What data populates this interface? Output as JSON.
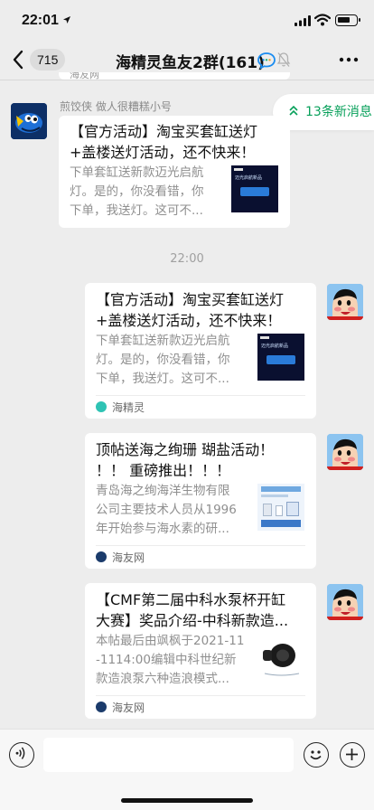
{
  "status": {
    "time": "22:01"
  },
  "nav": {
    "unread_count": "715",
    "title": "海精灵鱼友2群(161)"
  },
  "peek_text": "海友网",
  "new_messages": "13条新消息",
  "timestamp": "22:00",
  "messages": [
    {
      "sender": "煎饺侠 做人很糟糕小号",
      "title_lines": [
        "【官方活动】淘宝买套缸送灯",
        "+盖楼送灯活动，还不快来！"
      ],
      "desc_lines": [
        "下单套缸送新款迈光启航",
        "灯。是的，你没看错，你",
        "下单，我送灯。这可不..."
      ],
      "thumb_text": "迈光启航新品"
    },
    {
      "title_lines": [
        "【官方活动】淘宝买套缸送灯",
        "+盖楼送灯活动，还不快来！"
      ],
      "desc_lines": [
        "下单套缸送新款迈光启航",
        "灯。是的，你没看错，你",
        "下单，我送灯。这可不..."
      ],
      "thumb_text": "迈光启航新品",
      "source": "海精灵"
    },
    {
      "title_lines": [
        "顶帖送海之绚珊 瑚盐活动！",
        "！！ 重磅推出！！！"
      ],
      "desc_lines": [
        "青岛海之绚海洋生物有限",
        "公司主要技术人员从1996",
        "年开始参与海水素的研..."
      ],
      "source": "海友网"
    },
    {
      "title_lines": [
        "【CMF第二届中科水泵杯开缸",
        "大赛】奖品介绍-中科新款造..."
      ],
      "desc_lines": [
        "本帖最后由飒枫于2021-11",
        "-1114:00编辑中科世纪新",
        "款造浪泵六种造浪模式..."
      ],
      "source": "海友网"
    }
  ],
  "colors": {
    "accent_green": "#07a05a",
    "chat_bg": "#ededed"
  }
}
